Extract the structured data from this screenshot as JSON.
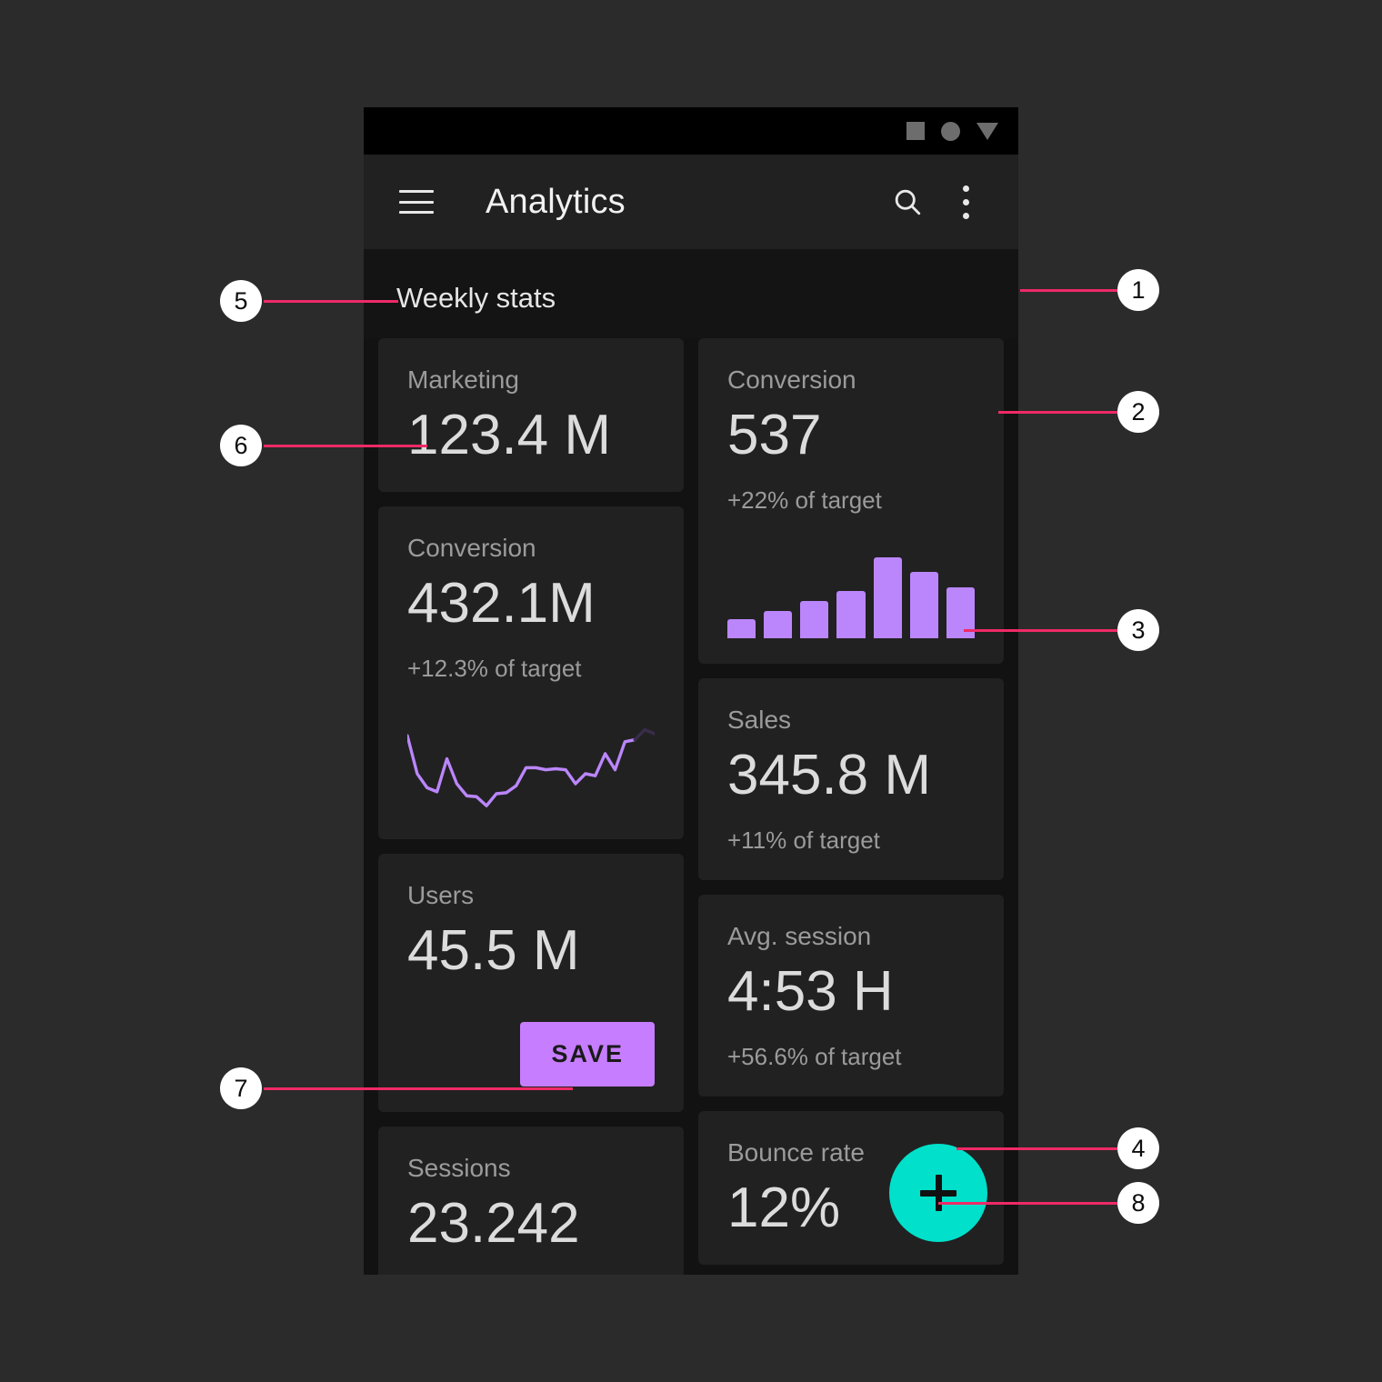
{
  "statusbar": {
    "icons": [
      "square-icon",
      "circle-icon",
      "triangle-down-icon"
    ]
  },
  "appbar": {
    "menu_icon": "hamburger-menu-icon",
    "title": "Analytics",
    "search_icon": "search-icon",
    "overflow_icon": "more-vert-icon"
  },
  "section": {
    "title": "Weekly stats"
  },
  "fab": {
    "icon": "plus-icon",
    "color": "#00e0ca"
  },
  "colors": {
    "accent_purple": "#bb86fc",
    "button_purple": "#c77dff",
    "fab_teal": "#00e0ca",
    "callout_pink": "#ef2a67",
    "card_bg": "#212121",
    "page_bg": "#121212"
  },
  "cards": {
    "marketing": {
      "label": "Marketing",
      "value": "123.4 M"
    },
    "conversion_line": {
      "label": "Conversion",
      "value": "432.1M",
      "sub": "+12.3% of target"
    },
    "users": {
      "label": "Users",
      "value": "45.5 M",
      "button": "SAVE"
    },
    "sessions": {
      "label": "Sessions",
      "value": "23.242"
    },
    "conversion_bar": {
      "label": "Conversion",
      "value": "537",
      "sub": "+22% of target"
    },
    "sales": {
      "label": "Sales",
      "value": "345.8 M",
      "sub": "+11% of target"
    },
    "avg_session": {
      "label": "Avg. session",
      "value": "4:53 H",
      "sub": "+56.6% of target"
    },
    "bounce_rate": {
      "label": "Bounce rate",
      "value": "12%"
    }
  },
  "chart_data": [
    {
      "type": "bar",
      "title": "Conversion",
      "categories": [
        "1",
        "2",
        "3",
        "4",
        "5",
        "6",
        "7"
      ],
      "values": [
        22,
        31,
        43,
        54,
        93,
        76,
        58
      ],
      "ylim": [
        0,
        100
      ],
      "xlabel": "",
      "ylabel": "",
      "grid": false,
      "legend": "none",
      "series_color": "#bb86fc"
    },
    {
      "type": "line",
      "title": "Conversion",
      "x": [
        0,
        1,
        2,
        3,
        4,
        5,
        6,
        7,
        8,
        9,
        10,
        11,
        12,
        13,
        14,
        15,
        16,
        17,
        18,
        19,
        20,
        21,
        22,
        23,
        24,
        25
      ],
      "values": [
        78,
        40,
        26,
        22,
        55,
        30,
        18,
        17,
        8,
        20,
        21,
        28,
        46,
        46,
        44,
        45,
        44,
        30,
        40,
        38,
        60,
        44,
        72,
        74,
        84,
        80
      ],
      "ylim": [
        0,
        100
      ],
      "xlabel": "",
      "ylabel": "",
      "grid": false,
      "legend": "none",
      "series_color": "#bb86fc",
      "tail_color": "#3a2d4a",
      "tail_from_index": 23
    }
  ],
  "callouts": [
    {
      "number": "1"
    },
    {
      "number": "2"
    },
    {
      "number": "3"
    },
    {
      "number": "4"
    },
    {
      "number": "5"
    },
    {
      "number": "6"
    },
    {
      "number": "7"
    },
    {
      "number": "8"
    }
  ]
}
